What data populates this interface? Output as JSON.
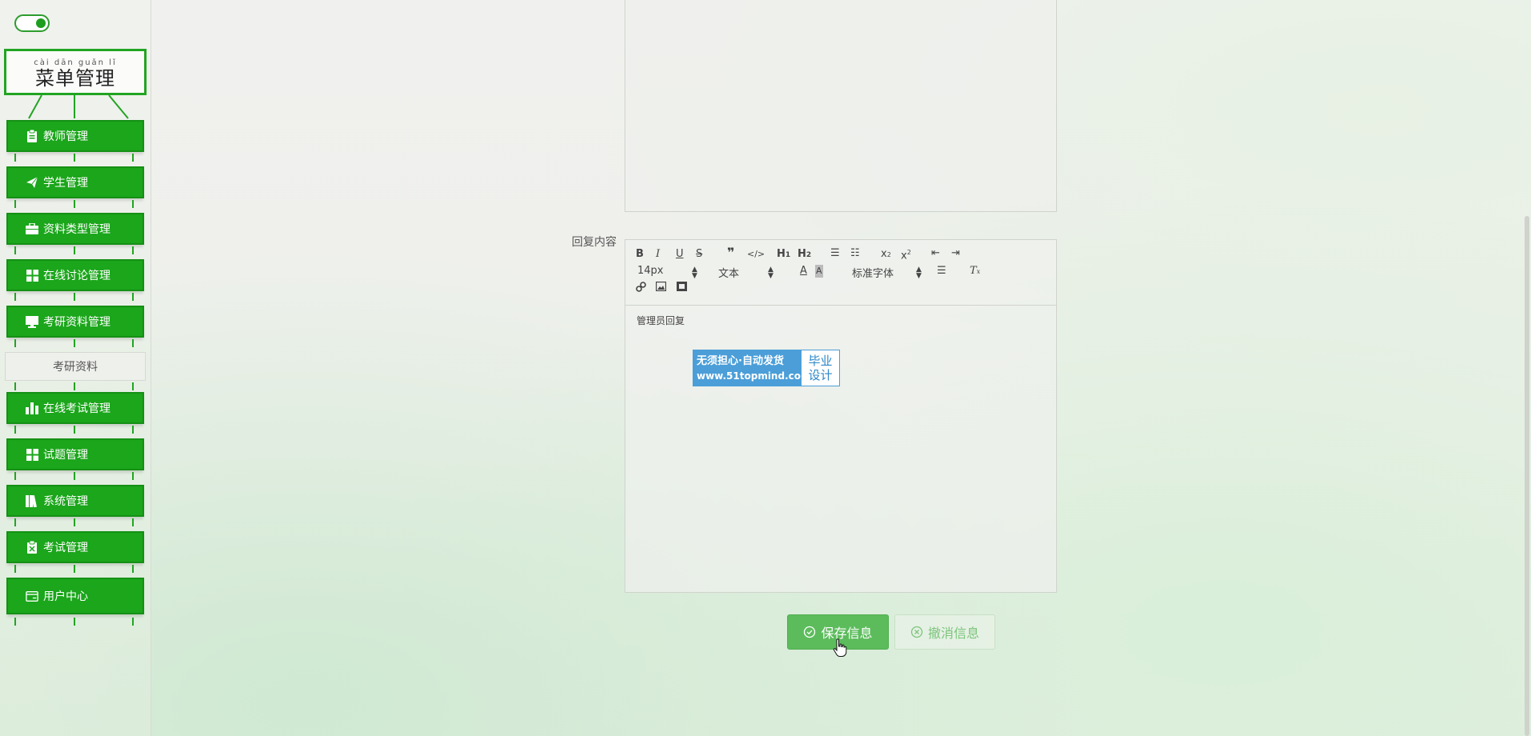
{
  "sidebar": {
    "menu_title": "菜单管理",
    "menu_title_pinyin": "cài dān guǎn lǐ",
    "items": [
      {
        "label": "教师管理",
        "icon": "clipboard-icon"
      },
      {
        "label": "学生管理",
        "icon": "paper-plane-icon"
      },
      {
        "label": "资料类型管理",
        "icon": "briefcase-icon"
      },
      {
        "label": "在线讨论管理",
        "icon": "grid-icon"
      },
      {
        "label": "考研资料管理",
        "icon": "monitor-icon"
      },
      {
        "label": "考研资料",
        "icon": ""
      },
      {
        "label": "在线考试管理",
        "icon": "bar-chart-icon"
      },
      {
        "label": "试题管理",
        "icon": "grid-icon"
      },
      {
        "label": "系统管理",
        "icon": "books-icon"
      },
      {
        "label": "考试管理",
        "icon": "clipboard-x-icon"
      },
      {
        "label": "用户中心",
        "icon": "card-icon"
      }
    ]
  },
  "form": {
    "reply_label": "回复内容",
    "editor": {
      "font_size": "14px",
      "paragraph": "文本",
      "font_family": "标准字体",
      "content": "管理员回复"
    }
  },
  "watermark": {
    "line1": "无须担心·自动发货",
    "line2": "www.51topmind.com",
    "badge1": "毕业",
    "badge2": "设计"
  },
  "buttons": {
    "save": "保存信息",
    "cancel": "撤消信息"
  },
  "colors": {
    "accent": "#1ba61b",
    "save": "#5cbc5c"
  }
}
